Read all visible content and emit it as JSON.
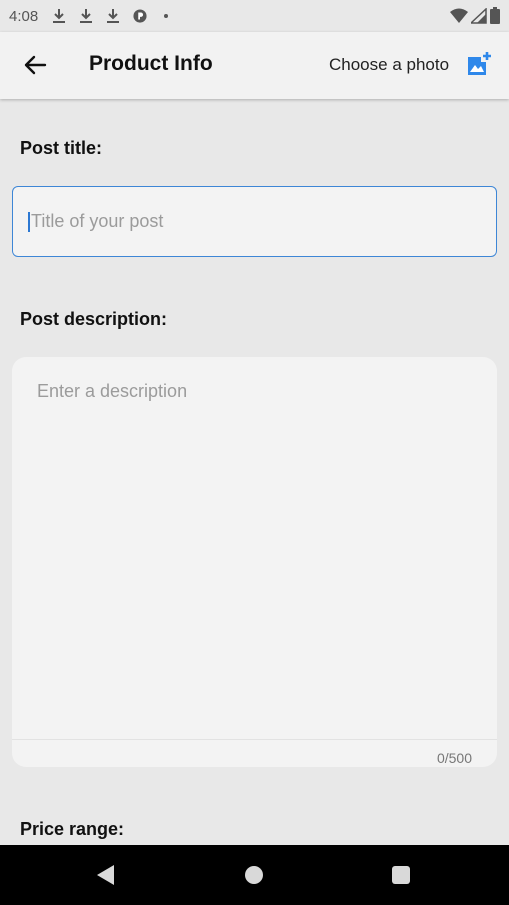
{
  "status_bar": {
    "time": "4:08",
    "icons": [
      "download-icon",
      "download-icon",
      "download-icon",
      "app-status-icon",
      "dot-icon"
    ],
    "right_icons": [
      "wifi-icon",
      "signal-icon",
      "battery-icon"
    ]
  },
  "app_bar": {
    "title": "Product Info",
    "choose_photo_label": "Choose a photo",
    "back_icon": "arrow-left-icon",
    "photo_icon": "add-photo-icon"
  },
  "form": {
    "title_label": "Post title:",
    "title_placeholder": "Title of your post",
    "description_label": "Post description:",
    "description_placeholder": "Enter a description",
    "description_counter": "0/500",
    "price_label": "Price range:"
  },
  "colors": {
    "accent": "#3d86d6",
    "photo_icon": "#2f88ea",
    "background": "#e8e8e8",
    "field_background": "#f3f3f3"
  }
}
